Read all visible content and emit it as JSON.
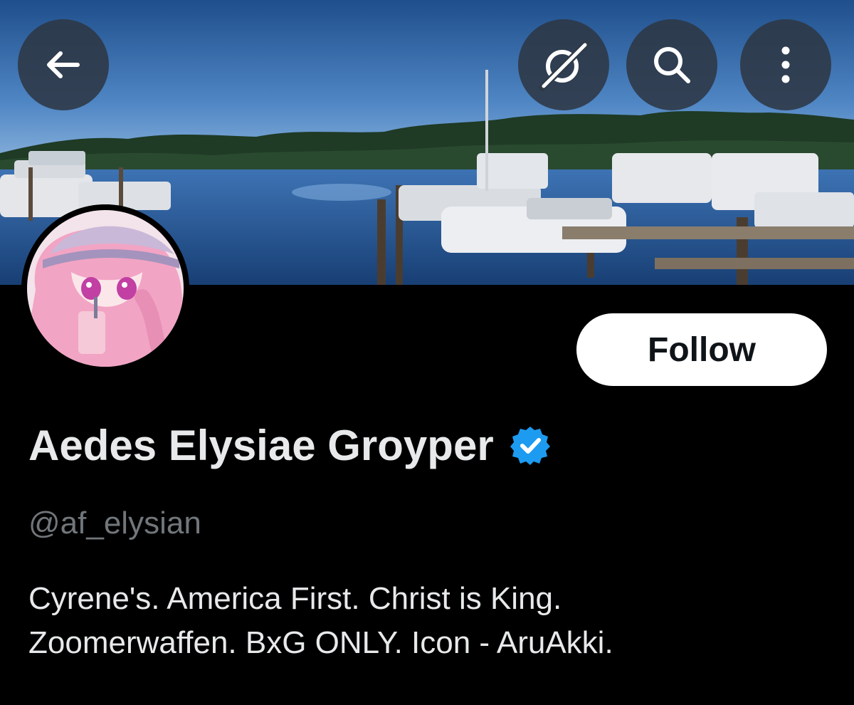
{
  "header": {
    "back_icon": "arrow-left-icon",
    "grok_icon": "grok-icon",
    "search_icon": "search-icon",
    "more_icon": "more-vertical-icon"
  },
  "profile": {
    "display_name": "Aedes Elysiae Groyper",
    "verified": true,
    "verified_color": "#1d9bf0",
    "handle": "@af_elysian",
    "bio_lines": [
      "Cyrene's. America First. Christ is King.",
      "Zoomerwaffen. BxG ONLY. Icon - AruAkki."
    ]
  },
  "actions": {
    "follow_label": "Follow"
  },
  "colors": {
    "background": "#000000",
    "text_primary": "#e7e9ea",
    "text_secondary": "#71767b",
    "button_bg": "#ffffff",
    "button_text": "#0f1419"
  }
}
